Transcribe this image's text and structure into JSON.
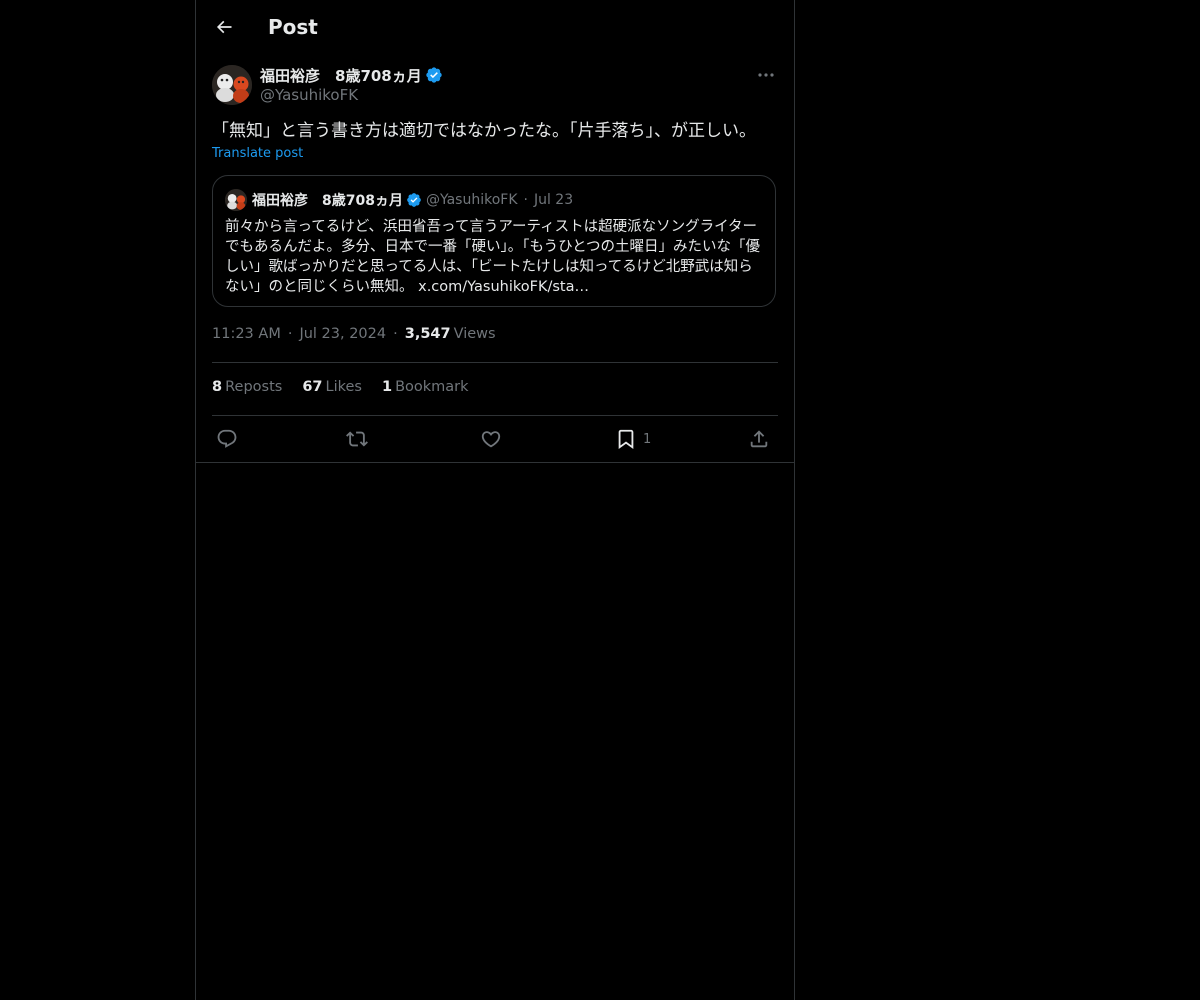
{
  "header": {
    "title": "Post",
    "back_icon": "arrow-left-icon"
  },
  "post": {
    "author_name": "福田裕彦　8歳708ヵ月",
    "author_handle": "@YasuhikoFK",
    "text": "「無知」と言う書き方は適切ではなかったな。「片手落ち」、が正しい。",
    "translate_label": "Translate post",
    "time": "11:23 AM",
    "date": "Jul 23, 2024",
    "views_count": "3,547",
    "views_label": "Views"
  },
  "quote": {
    "author_name": "福田裕彦　8歳708ヵ月",
    "author_handle": "@YasuhikoFK",
    "date": "Jul 23",
    "text": "前々から言ってるけど、浜田省吾って言うアーティストは超硬派なソングライターでもあるんだよ。多分、日本で一番「硬い」。「もうひとつの土曜日」みたいな「優しい」歌ばっかりだと思ってる人は、「ビートたけしは知ってるけど北野武は知らない」のと同じくらい無知。 x.com/YasuhikoFK/sta…"
  },
  "stats": {
    "reposts_count": "8",
    "reposts_label": "Reposts",
    "likes_count": "67",
    "likes_label": "Likes",
    "bookmarks_count": "1",
    "bookmarks_label": "Bookmark"
  },
  "actions": {
    "reply_icon": "reply-icon",
    "repost_icon": "repost-icon",
    "like_icon": "heart-icon",
    "bookmark_icon": "bookmark-icon",
    "bookmark_count": "1",
    "share_icon": "share-icon"
  },
  "colors": {
    "background": "#000000",
    "text": "#e7e9ea",
    "secondary": "#71767b",
    "accent": "#1d9bf0",
    "border": "#2f3336"
  }
}
